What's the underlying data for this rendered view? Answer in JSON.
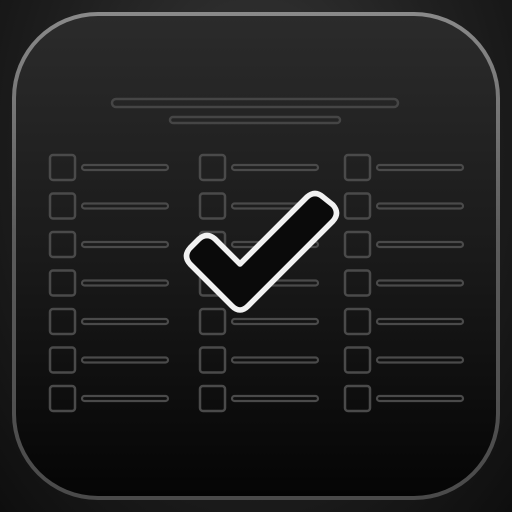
{
  "icon": {
    "name": "checklist-app-icon",
    "glyph": "checkmark-icon",
    "columns": 3,
    "rows_per_column": 7,
    "colors": {
      "background": "#1e1e1e",
      "tile_rim": "#6a6a6a",
      "tile_top": "#2b2b2b",
      "tile_bottom": "#050505",
      "checkbox_stroke": "#4a4a4a",
      "checkmark_fill": "#0a0a0a",
      "checkmark_stroke": "#ffffff"
    }
  }
}
